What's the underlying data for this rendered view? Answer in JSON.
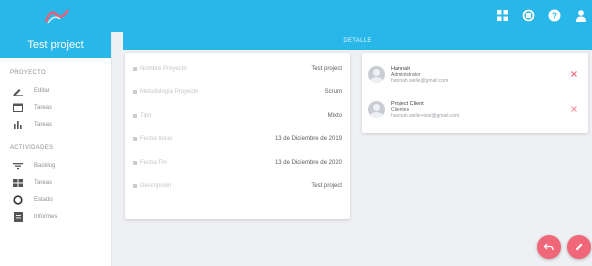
{
  "header": {
    "icons": [
      "grid-icon",
      "refresh-icon",
      "help-icon",
      "user-icon"
    ]
  },
  "sidebar": {
    "project_title": "Test project",
    "sections": [
      {
        "label": "Proyecto",
        "items": [
          {
            "label": "Editar",
            "icon": "edit-icon"
          },
          {
            "label": "Tareas",
            "icon": "calendar-icon"
          },
          {
            "label": "Tareas",
            "icon": "chart-icon"
          }
        ]
      },
      {
        "label": "Actividades",
        "items": [
          {
            "label": "Backlog",
            "icon": "sort-icon"
          },
          {
            "label": "Tareas",
            "icon": "board-icon"
          },
          {
            "label": "Estado",
            "icon": "circle-icon"
          },
          {
            "label": "Informes",
            "icon": "report-icon"
          }
        ]
      }
    ]
  },
  "main": {
    "bar_title": "DETALLE",
    "details": [
      {
        "label": "Nombre Proyecto",
        "value": "Test project"
      },
      {
        "label": "Metodología Proyecto",
        "value": "Scrum"
      },
      {
        "label": "Tipo",
        "value": "Mixto"
      },
      {
        "label": "Fecha Inicio",
        "value": "13 de Diciembre de 2019"
      },
      {
        "label": "Fecha Fin",
        "value": "13 de Diciembre de 2020"
      },
      {
        "label": "Descripción",
        "value": "Test project"
      }
    ],
    "members": [
      {
        "name": "Hannah",
        "role": "Administrator",
        "email": "hannah.welle@gmail.com"
      },
      {
        "name": "Project Client",
        "role": "Clientes",
        "email": "hannah.welle+test@gmail.com"
      }
    ]
  },
  "colors": {
    "primary": "#29b6e8",
    "accent": "#f06779",
    "background": "#eef0f3"
  }
}
